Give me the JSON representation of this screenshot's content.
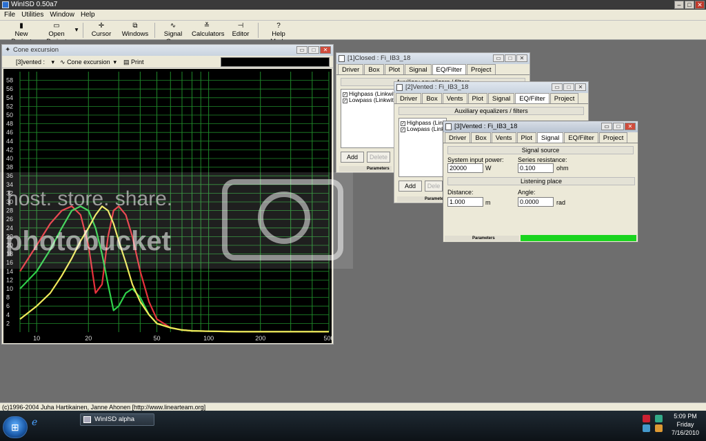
{
  "app": {
    "title": "WinISD 0.50a7"
  },
  "menu": [
    "File",
    "Utilities",
    "Window",
    "Help"
  ],
  "toolbar": {
    "new_project": "New Project",
    "open_project": "Open Project",
    "cursor": "Cursor",
    "windows": "Windows",
    "signal_gen": "Signal Gen.",
    "calculators": "Calculators",
    "editor": "Editor",
    "help_mode": "Help Mode"
  },
  "cone_window": {
    "title": "Cone excursion",
    "project_select": "[3]vented :",
    "plot_select": "Cone excursion",
    "print": "Print"
  },
  "chart_data": {
    "type": "line",
    "title": "",
    "xlabel": "",
    "ylabel": "",
    "x_scale": "log",
    "xlim": [
      8,
      500
    ],
    "ylim": [
      0,
      60
    ],
    "x_ticks": [
      10,
      20,
      50,
      100,
      200,
      500
    ],
    "y_ticks": [
      2,
      4,
      6,
      8,
      10,
      12,
      14,
      16,
      18,
      20,
      22,
      24,
      26,
      28,
      30,
      32,
      34,
      36,
      38,
      40,
      42,
      44,
      46,
      48,
      50,
      52,
      54,
      56,
      58
    ],
    "grid": true,
    "legend": "none",
    "series": [
      {
        "color": "#e8323c",
        "x": [
          8,
          10,
          12,
          14,
          16,
          18,
          20,
          22,
          24,
          26,
          28,
          30,
          33,
          36,
          40,
          45,
          50,
          60,
          70,
          80,
          100,
          150,
          200,
          500
        ],
        "y": [
          14,
          20,
          25,
          28,
          29,
          27,
          20,
          9,
          11,
          22,
          28,
          29,
          27,
          22,
          14,
          7,
          3,
          1,
          0.5,
          0.3,
          0.2,
          0.1,
          0.1,
          0.1
        ]
      },
      {
        "color": "#2fd04a",
        "x": [
          8,
          10,
          12,
          14,
          16,
          18,
          20,
          22,
          24,
          26,
          28,
          30,
          33,
          36,
          40,
          45,
          50,
          60,
          70,
          80,
          100,
          150,
          200,
          500
        ],
        "y": [
          10,
          14,
          19,
          24,
          28,
          29,
          28,
          24,
          18,
          11,
          5,
          6,
          9,
          10,
          8,
          4,
          2,
          1,
          0.5,
          0.3,
          0.2,
          0.1,
          0.1,
          0.1
        ]
      },
      {
        "color": "#f0e85a",
        "x": [
          8,
          10,
          12,
          14,
          16,
          18,
          20,
          22,
          24,
          26,
          28,
          30,
          33,
          36,
          40,
          45,
          50,
          60,
          70,
          80,
          100,
          150,
          200,
          500
        ],
        "y": [
          3,
          6,
          9,
          13,
          17,
          21,
          24,
          27,
          29,
          28,
          25,
          21,
          16,
          11,
          7,
          4,
          2,
          1,
          0.5,
          0.3,
          0.2,
          0.1,
          0.1,
          0.1
        ]
      }
    ]
  },
  "win1": {
    "title": "[1]Closed : Fi_IB3_18",
    "tabs": [
      "Driver",
      "Box",
      "Plot",
      "Signal",
      "EQ/Filter",
      "Project"
    ],
    "header": "Auxiliary equalizers / filters",
    "items": [
      "Highpass (Linkwitz-",
      "Lowpass (Linkwitz-"
    ],
    "add": "Add",
    "delete": "Delete",
    "params": "Parameters"
  },
  "win2": {
    "title": "[2]Vented : Fi_IB3_18",
    "tabs": [
      "Driver",
      "Box",
      "Vents",
      "Plot",
      "Signal",
      "EQ/Filter",
      "Project"
    ],
    "header": "Auxiliary equalizers / filters",
    "items": [
      "Highpass (Link",
      "Lowpass (Link"
    ],
    "add": "Add",
    "delete": "Dele",
    "params": "Parameters"
  },
  "win3": {
    "title": "[3]Vented : Fi_IB3_18",
    "tabs": [
      "Driver",
      "Box",
      "Vents",
      "Plot",
      "Signal",
      "EQ/Filter",
      "Project"
    ],
    "signal_source": "Signal source",
    "sys_power_label": "System input power:",
    "sys_power_value": "20000",
    "sys_power_unit": "W",
    "series_res_label": "Series resistance:",
    "series_res_value": "0.100",
    "series_res_unit": "ohm",
    "listening_place": "Listening place",
    "distance_label": "Distance:",
    "distance_value": "1.000",
    "distance_unit": "m",
    "angle_label": "Angle:",
    "angle_value": "0.0000",
    "angle_unit": "rad",
    "params": "Parameters"
  },
  "statusbar": "(c)1996-2004 Juha Hartikainen, Janne Ahonen [http://www.linearteam.org]",
  "watermark": {
    "line1": "host. store. share.",
    "line2": "photobucket"
  },
  "taskbar": {
    "task": "WinISD alpha",
    "time": "5:09 PM",
    "day": "Friday",
    "date": "7/16/2010"
  },
  "colors": {
    "accent_green": "#19d41e",
    "plot_bg": "#000000",
    "grid": "#1f8a2a"
  }
}
